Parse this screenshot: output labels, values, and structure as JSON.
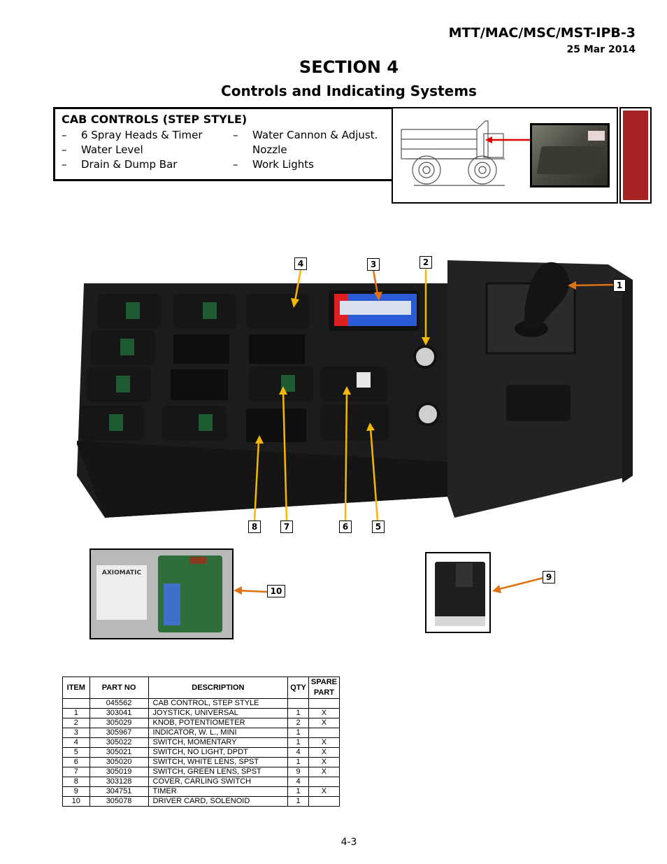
{
  "header": {
    "doc_id": "MTT/MAC/MSC/MST-IPB-3",
    "date": "25 Mar 2014"
  },
  "section": {
    "title": "SECTION 4",
    "subtitle": "Controls and Indicating Systems"
  },
  "cab_box": {
    "title": "CAB CONTROLS (STEP STYLE)",
    "left_items": [
      "6 Spray Heads & Timer",
      "Water Level",
      "Drain & Dump Bar"
    ],
    "right_items": [
      "Water Cannon & Adjust.",
      "Nozzle",
      "Work Lights"
    ],
    "dash": "–"
  },
  "colors": {
    "section_tab": "#a52323",
    "callout_arrow_orange": "#e07010",
    "callout_arrow_yellow": "#f5b800",
    "locator_arrow": "#e00000"
  },
  "callouts": [
    "1",
    "2",
    "3",
    "4",
    "5",
    "6",
    "7",
    "8",
    "9",
    "10"
  ],
  "parts_table": {
    "headers": [
      "ITEM",
      "PART NO",
      "DESCRIPTION",
      "QTY",
      "SPARE PART"
    ],
    "rows": [
      {
        "item": "",
        "part_no": "045562",
        "description": "CAB CONTROL, STEP STYLE",
        "qty": "",
        "spare": ""
      },
      {
        "item": "1",
        "part_no": "303041",
        "description": "JOYSTICK, UNIVERSAL",
        "qty": "1",
        "spare": "X"
      },
      {
        "item": "2",
        "part_no": "305029",
        "description": "KNOB, POTENTIOMETER",
        "qty": "2",
        "spare": "X"
      },
      {
        "item": "3",
        "part_no": "305967",
        "description": "INDICATOR, W. L., MINI",
        "qty": "1",
        "spare": ""
      },
      {
        "item": "4",
        "part_no": "305022",
        "description": "SWITCH, MOMENTARY",
        "qty": "1",
        "spare": "X"
      },
      {
        "item": "5",
        "part_no": "305021",
        "description": "SWITCH, NO LIGHT, DPDT",
        "qty": "4",
        "spare": "X"
      },
      {
        "item": "6",
        "part_no": "305020",
        "description": "SWITCH, WHITE LENS, SPST",
        "qty": "1",
        "spare": "X"
      },
      {
        "item": "7",
        "part_no": "305019",
        "description": "SWITCH, GREEN LENS, SPST",
        "qty": "9",
        "spare": "X"
      },
      {
        "item": "8",
        "part_no": "303128",
        "description": "COVER, CARLING SWITCH",
        "qty": "4",
        "spare": ""
      },
      {
        "item": "9",
        "part_no": "304751",
        "description": "TIMER",
        "qty": "1",
        "spare": "X"
      },
      {
        "item": "10",
        "part_no": "305078",
        "description": "DRIVER CARD, SOLENOID",
        "qty": "1",
        "spare": ""
      }
    ]
  },
  "driver_card_label": "AXIOMATIC",
  "page_number": "4-3"
}
